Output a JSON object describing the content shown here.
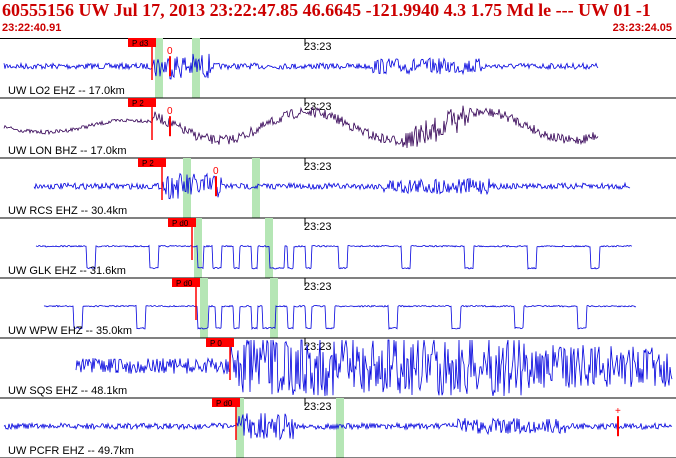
{
  "header": {
    "title": "60555156 UW Jul 17, 2013 23:22:47.85   46.6645 -121.9940  4.3 1.75 Md le --- UW 01  -1",
    "start_time": "23:22:40.91",
    "end_time": "23:23:24.05"
  },
  "colors": {
    "header_text": "#cc0000",
    "trace_blue": "#0000dd",
    "trace_purple": "#330055",
    "pick_red": "#ff0000",
    "window_green": "#b5e6b5"
  },
  "minute_label": "23:23",
  "traces": [
    {
      "station": "UW LO2 EHZ -- 17.0km",
      "pick": "P d3",
      "mark": "0",
      "color": "blue",
      "style": "noise"
    },
    {
      "station": "UW LON BHZ -- 17.0km",
      "pick": "P 2",
      "mark": "0",
      "color": "purple",
      "style": "wave"
    },
    {
      "station": "UW RCS EHZ -- 30.4km",
      "pick": "P 2",
      "mark": "0",
      "color": "blue",
      "style": "noise"
    },
    {
      "station": "UW GLK EHZ -- 31.6km",
      "pick": "P d0",
      "mark": "",
      "color": "blue",
      "style": "square"
    },
    {
      "station": "UW WPW EHZ -- 35.0km",
      "pick": "P d0",
      "mark": "",
      "color": "blue",
      "style": "square"
    },
    {
      "station": "UW SQS EHZ -- 48.1km",
      "pick": "P 0",
      "mark": "",
      "color": "blue",
      "style": "burst"
    },
    {
      "station": "UW PCFR EHZ -- 49.7km",
      "pick": "P d0",
      "mark": "+",
      "color": "blue",
      "style": "noise"
    }
  ]
}
